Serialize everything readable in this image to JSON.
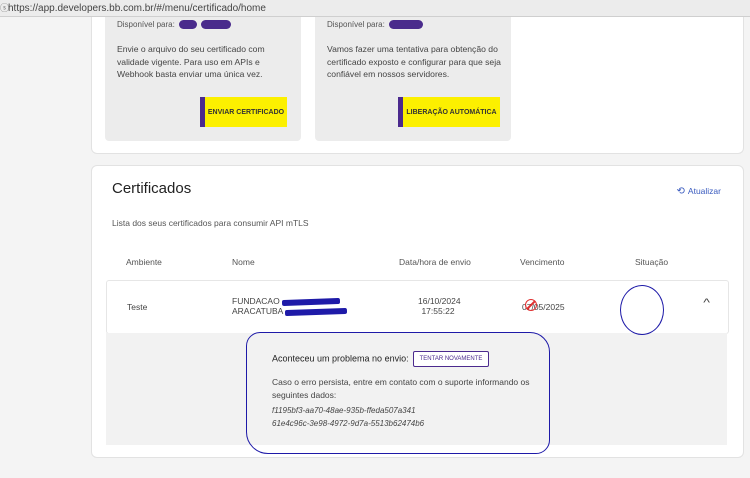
{
  "browser": {
    "url": "https://app.developers.bb.com.br/#/menu/certificado/home"
  },
  "cards": [
    {
      "available_label": "Disponível para:",
      "description": "Envie o arquivo do seu certificado com validade vigente. Para uso em APIs e Webhook basta enviar uma única vez.",
      "button": "ENVIAR CERTIFICADO"
    },
    {
      "available_label": "Disponível para:",
      "description": "Vamos fazer uma tentativa para obtenção do certificado exposto e configurar para que seja confiável em nossos servidores.",
      "button": "LIBERAÇÃO AUTOMÁTICA"
    }
  ],
  "certificates": {
    "title": "Certificados",
    "refresh_label": "Atualizar",
    "subtitle": "Lista dos seus certificados para consumir API mTLS",
    "columns": [
      "Ambiente",
      "Nome",
      "Data/hora de envio",
      "Vencimento",
      "Situação"
    ],
    "row": {
      "ambiente": "Teste",
      "name_line1": "FUNDACAO",
      "name_line2": "ARACATUBA",
      "date": "16/10/2024",
      "time": "17:55:22",
      "vencimento": "07/05/2025"
    },
    "detail": {
      "problem_text": "Aconteceu um problema no envio:",
      "retry_button": "TENTAR NOVAMENTE",
      "help_text": "Caso o erro persista, entre em contato com o suporte informando os seguintes dados:",
      "id1": "f1195bf3-aa70-48ae-935b-ffeda507a341",
      "id2": "61e4c96c-3e98-4972-9d7a-5513b62474b6"
    }
  },
  "colors": {
    "accent_purple": "#4b2a8e",
    "accent_yellow": "#fcf000",
    "error_red": "#e03030",
    "annotation_blue": "#1e1aa8"
  }
}
